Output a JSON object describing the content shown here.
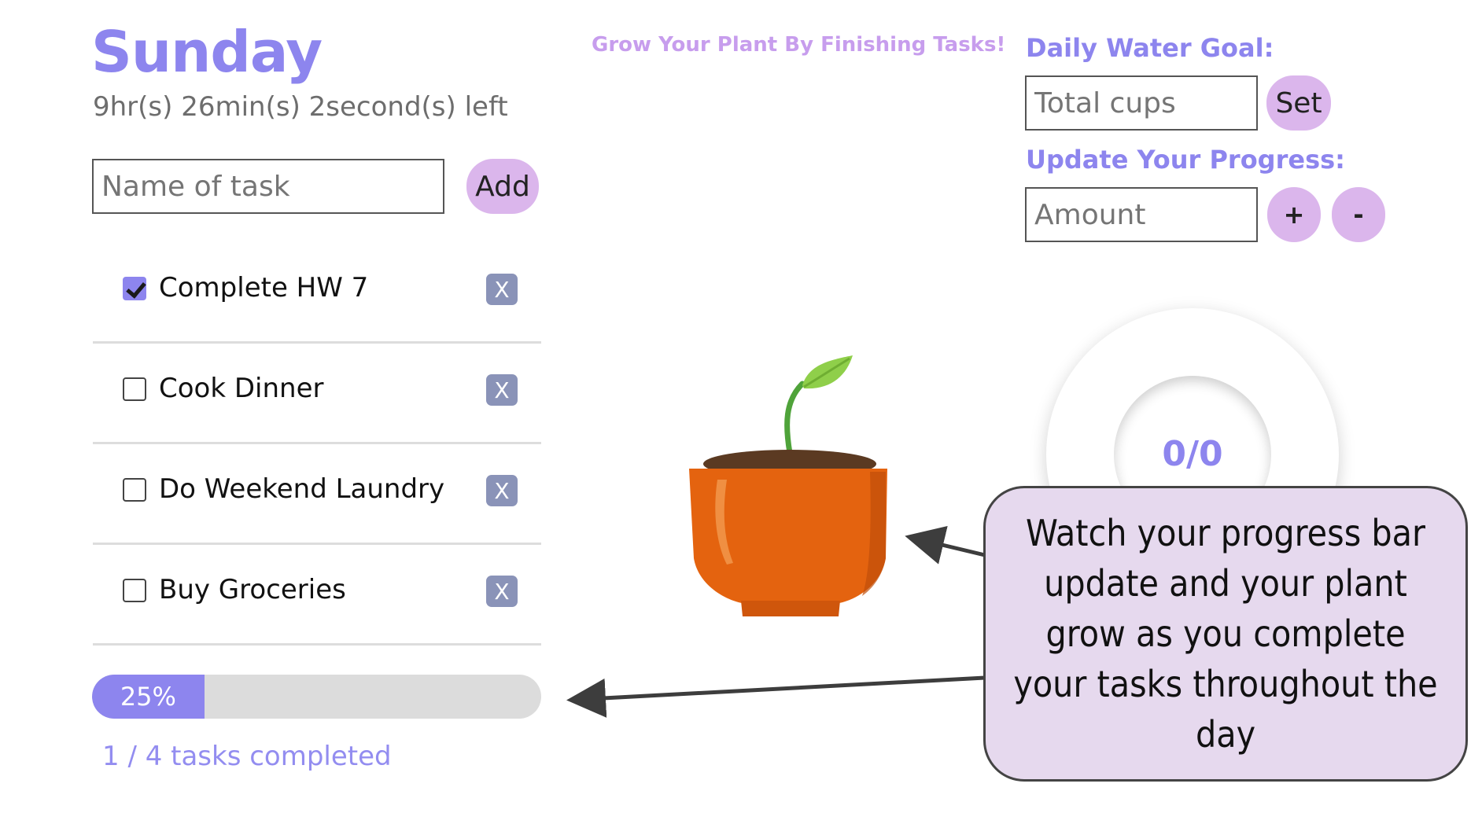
{
  "header": {
    "day": "Sunday",
    "time_left": "9hr(s) 26min(s) 2second(s) left"
  },
  "task_form": {
    "placeholder": "Name of task",
    "add_label": "Add"
  },
  "tasks": [
    {
      "label": "Complete HW 7",
      "done": true,
      "delete_label": "X"
    },
    {
      "label": "Cook Dinner",
      "done": false,
      "delete_label": "X"
    },
    {
      "label": "Do Weekend Laundry",
      "done": false,
      "delete_label": "X"
    },
    {
      "label": "Buy Groceries",
      "done": false,
      "delete_label": "X"
    }
  ],
  "progress": {
    "percent_label": "25%",
    "percent": 25,
    "summary": "1 / 4 tasks completed"
  },
  "plant": {
    "title": "Grow Your Plant By Finishing Tasks!"
  },
  "water": {
    "goal_heading": "Daily Water Goal:",
    "goal_placeholder": "Total cups",
    "set_label": "Set",
    "update_heading": "Update Your Progress:",
    "amount_placeholder": "Amount",
    "plus_label": "+",
    "minus_label": "-",
    "gauge_text": "0/0"
  },
  "callout": {
    "text": "Watch your progress bar update and your plant grow as you complete your tasks throughout the day"
  },
  "colors": {
    "accent": "#8d85ee",
    "button": "#dbb6ec",
    "callout_bg": "#e6d9ee",
    "pot": "#e4630f"
  }
}
